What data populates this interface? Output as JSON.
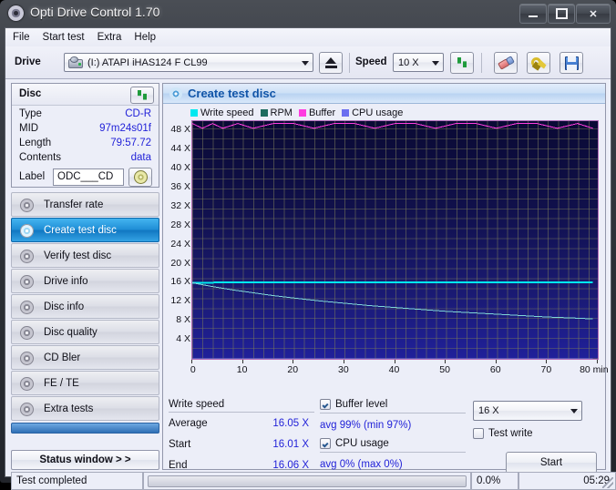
{
  "window": {
    "title": "Opti Drive Control 1.70",
    "title_icon": "disc-icon",
    "minimize": "─",
    "maximize": "□",
    "close": "✕"
  },
  "menubar": {
    "items": [
      "File",
      "Start test",
      "Extra",
      "Help"
    ]
  },
  "toolbar": {
    "drive_label": "Drive",
    "drive_value": "(I:)   ATAPI iHAS124   F CL99",
    "eject_icon": "eject-icon",
    "speed_label": "Speed",
    "speed_value": "10 X",
    "refresh_icon": "refresh-icon",
    "eraser_icon": "eraser-icon",
    "tools_icon": "tools-icon",
    "save_icon": "save-floppy-icon"
  },
  "disc_panel": {
    "header": "Disc",
    "refresh_icon": "refresh-icon",
    "rows": [
      {
        "key": "Type",
        "value": "CD-R"
      },
      {
        "key": "MID",
        "value": "97m24s01f"
      },
      {
        "key": "Length",
        "value": "79:57.72"
      },
      {
        "key": "Contents",
        "value": "data"
      }
    ],
    "label_key": "Label",
    "label_value": "ODC___CD",
    "disc_icon": "cd-disc-icon"
  },
  "sidebar": {
    "items": [
      {
        "label": "Transfer rate",
        "selected": false,
        "icon": "disc-icon"
      },
      {
        "label": "Create test disc",
        "selected": true,
        "icon": "disc-icon"
      },
      {
        "label": "Verify test disc",
        "selected": false,
        "icon": "disc-icon"
      },
      {
        "label": "Drive info",
        "selected": false,
        "icon": "disc-icon"
      },
      {
        "label": "Disc info",
        "selected": false,
        "icon": "disc-icon"
      },
      {
        "label": "Disc quality",
        "selected": false,
        "icon": "disc-icon"
      },
      {
        "label": "CD Bler",
        "selected": false,
        "icon": "disc-icon"
      },
      {
        "label": "FE / TE",
        "selected": false,
        "icon": "disc-icon"
      },
      {
        "label": "Extra tests",
        "selected": false,
        "icon": "disc-icon"
      }
    ],
    "status_window_button": "Status window > >"
  },
  "content": {
    "title": "Create test disc",
    "title_icon": "disc-icon"
  },
  "results": {
    "write_speed_header": "Write speed",
    "rows": [
      {
        "key": "Average",
        "value": "16.05 X"
      },
      {
        "key": "Start",
        "value": "16.01 X"
      },
      {
        "key": "End",
        "value": "16.06 X"
      }
    ],
    "buffer_level_label": "Buffer level",
    "buffer_level_checked": true,
    "buffer_stat": "avg 99% (min 97%)",
    "cpu_usage_label": "CPU usage",
    "cpu_usage_checked": true,
    "cpu_stat": "avg 0% (max 0%)",
    "write_speed_select": "16 X",
    "test_write_label": "Test write",
    "test_write_checked": false,
    "start_button": "Start"
  },
  "statusbar": {
    "message": "Test completed",
    "progress_text": "0.0%",
    "progress_value": 0,
    "time": "05:29"
  },
  "colors": {
    "write_speed": "#00e8f0",
    "rpm": "#1d6b5e",
    "buffer": "#ff3ce0",
    "cpu_usage": "#6a6ef0",
    "plot_bg_top": "#0a0a35",
    "plot_bg_bottom": "#20209a",
    "accent_blue": "#1155a8",
    "value_blue": "#2222d8"
  },
  "chart_data": {
    "type": "line",
    "title": "Create test disc",
    "xlabel": "min",
    "ylabel": "X",
    "xlim": [
      0,
      80
    ],
    "ylim": [
      0,
      50
    ],
    "xticks": [
      0,
      10,
      20,
      30,
      40,
      50,
      60,
      70,
      80
    ],
    "xticklabels": [
      "0",
      "10",
      "20",
      "30",
      "40",
      "50",
      "60",
      "70",
      "80 min"
    ],
    "yticks": [
      4,
      8,
      12,
      16,
      20,
      24,
      28,
      32,
      36,
      40,
      44,
      48
    ],
    "yticklabels": [
      "4 X",
      "8 X",
      "12 X",
      "16 X",
      "20 X",
      "24 X",
      "28 X",
      "32 X",
      "36 X",
      "40 X",
      "44 X",
      "48 X"
    ],
    "grid": true,
    "legend": [
      {
        "name": "Write speed",
        "color": "#00e8f0"
      },
      {
        "name": "RPM",
        "color": "#1d6b5e"
      },
      {
        "name": "Buffer",
        "color": "#ff3ce0"
      },
      {
        "name": "CPU usage",
        "color": "#6a6ef0"
      }
    ],
    "series": [
      {
        "name": "Write speed",
        "color": "#00e8f0",
        "unit": "X",
        "x": [
          0,
          5,
          10,
          20,
          30,
          40,
          50,
          60,
          70,
          79
        ],
        "values": [
          16.01,
          16.05,
          16.05,
          16.05,
          16.06,
          16.05,
          16.05,
          16.06,
          16.05,
          16.06
        ]
      },
      {
        "name": "RPM",
        "color": "#7fd8d8",
        "unit": "X-equivalent",
        "x": [
          0,
          4,
          8,
          12,
          16,
          20,
          25,
          30,
          35,
          40,
          45,
          50,
          55,
          60,
          65,
          70,
          75,
          79
        ],
        "values": [
          16.0,
          15.2,
          14.5,
          13.9,
          13.3,
          12.8,
          12.2,
          11.7,
          11.2,
          10.8,
          10.4,
          10.0,
          9.7,
          9.4,
          9.1,
          8.8,
          8.6,
          8.4
        ]
      },
      {
        "name": "Buffer",
        "color": "#ff3ce0",
        "unit": "%",
        "scale_note": "plotted as % of full chart height",
        "x": [
          0,
          2,
          4,
          6,
          9,
          12,
          16,
          20,
          24,
          28,
          32,
          36,
          40,
          44,
          48,
          52,
          56,
          60,
          64,
          68,
          72,
          76,
          79
        ],
        "values": [
          99,
          97,
          99,
          97,
          99,
          97,
          99,
          99,
          97,
          99,
          99,
          97,
          99,
          99,
          97,
          99,
          99,
          97,
          99,
          99,
          97,
          99,
          97
        ]
      },
      {
        "name": "CPU usage",
        "color": "#6a6ef0",
        "unit": "%",
        "x": [
          0,
          20,
          40,
          60,
          79
        ],
        "values": [
          0,
          0,
          0,
          0,
          0
        ]
      }
    ],
    "annotations": {
      "write_speed_avg": "16.05 X",
      "write_speed_start": "16.01 X",
      "write_speed_end": "16.06 X",
      "buffer_summary": "avg 99% (min 97%)",
      "cpu_summary": "avg 0% (max 0%)"
    }
  }
}
